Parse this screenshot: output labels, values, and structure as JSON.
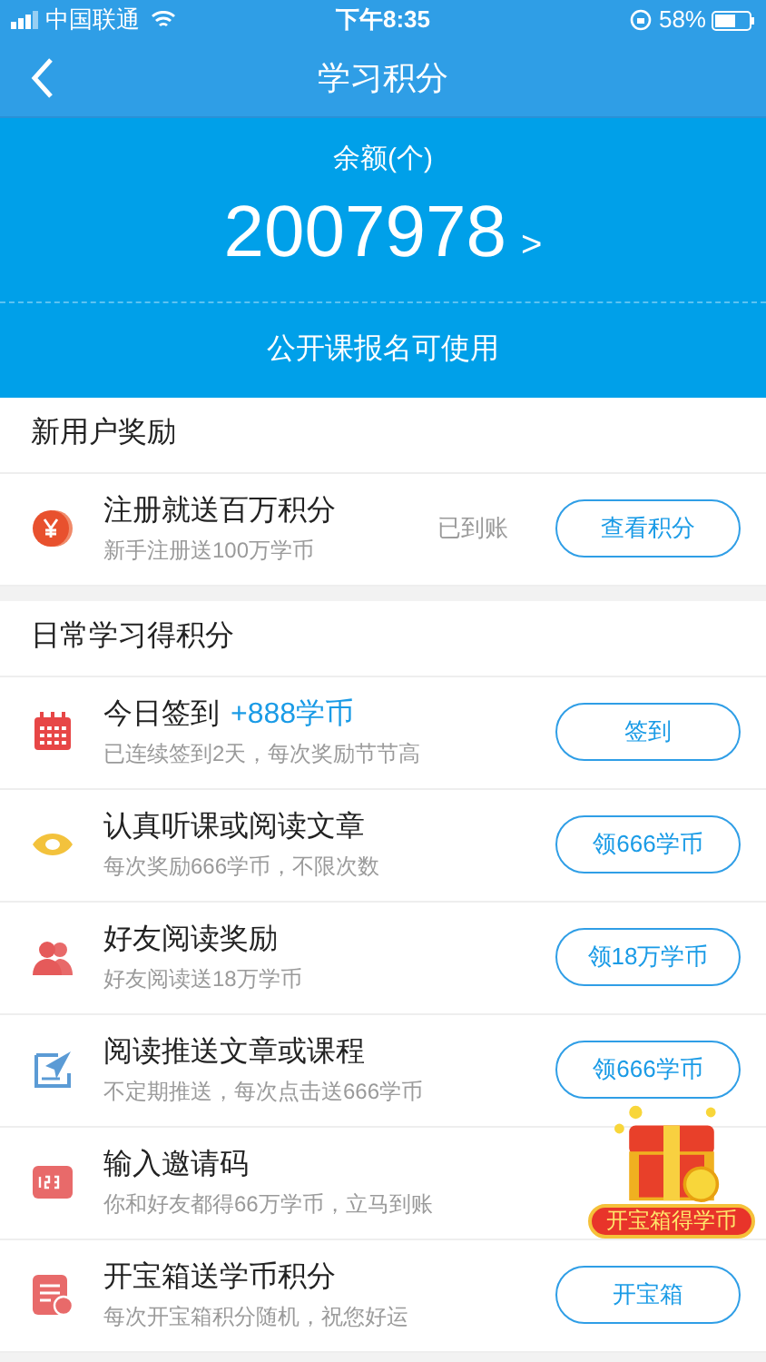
{
  "status_bar": {
    "carrier": "中国联通",
    "time": "下午8:35",
    "battery": "58%"
  },
  "nav": {
    "title": "学习积分"
  },
  "balance": {
    "label": "余额(个)",
    "value": "2007978",
    "arrow": ">",
    "note": "公开课报名可使用"
  },
  "sections": [
    {
      "title": "新用户奖励",
      "rows": [
        {
          "kind": "coin",
          "title": "注册就送百万积分",
          "subtitle": "新手注册送100万学币",
          "status": "已到账",
          "button": "查看积分"
        }
      ]
    },
    {
      "title": "日常学习得积分",
      "rows": [
        {
          "kind": "calendar",
          "title": "今日签到",
          "bonus": "+888学币",
          "subtitle": "已连续签到2天，每次奖励节节高",
          "button": "签到"
        },
        {
          "kind": "eye",
          "title": "认真听课或阅读文章",
          "subtitle": "每次奖励666学币，不限次数",
          "button": "领666学币"
        },
        {
          "kind": "people",
          "title": "好友阅读奖励",
          "subtitle": "好友阅读送18万学币",
          "button": "领18万学币"
        },
        {
          "kind": "article",
          "title": "阅读推送文章或课程",
          "subtitle": "不定期推送，每次点击送666学币",
          "button": "领666学币"
        },
        {
          "kind": "code",
          "title": "输入邀请码",
          "subtitle": "你和好友都得66万学币，立马到账",
          "chest": true
        },
        {
          "kind": "bill",
          "title": "开宝箱送学币积分",
          "subtitle": "每次开宝箱积分随机，祝您好运",
          "button": "开宝箱"
        }
      ]
    }
  ],
  "treasure_badge": {
    "label": "开宝箱得学币"
  }
}
